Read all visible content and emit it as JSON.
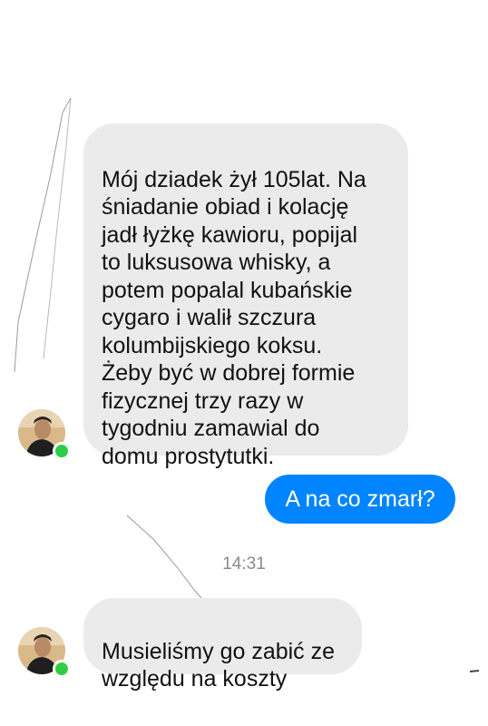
{
  "messages": [
    {
      "direction": "incoming",
      "text": "Mój dziadek żył 105lat. Na\nśniadanie obiad i kolację\njadł łyżkę kawioru, popijal\nto luksusowa whisky, a\npotem popalal kubańskie\ncygaro i walił szczura\nkolumbijskiego koksu.\nŻeby być w dobrej formie\nfizycznej trzy razy w\ntygodniu zamawial do\ndomu prostytutki."
    },
    {
      "direction": "outgoing",
      "text": "A na co zmarł?"
    },
    {
      "direction": "incoming",
      "text": "Musieliśmy go zabić ze\nwzględu na koszty"
    }
  ],
  "timestamp": "14:31",
  "colors": {
    "outgoing_bubble": "#0084ff",
    "incoming_bubble": "#ebebeb",
    "online_status": "#31cc46",
    "timestamp": "#8a8a8a"
  },
  "icons": [
    "avatar",
    "online-status-icon"
  ]
}
